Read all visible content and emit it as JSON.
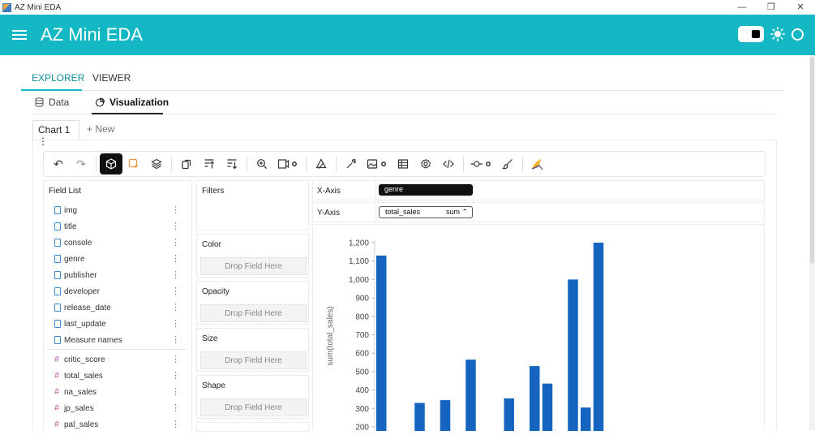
{
  "window": {
    "title": "AZ Mini EDA",
    "controls": [
      "—",
      "❐",
      "✕"
    ]
  },
  "appbar": {
    "title": "AZ Mini EDA"
  },
  "main_tabs": [
    {
      "label": "EXPLORER"
    },
    {
      "label": "VIEWER"
    }
  ],
  "sub_tabs": [
    {
      "label": "Data"
    },
    {
      "label": "Visualization"
    }
  ],
  "chart_tabs": {
    "current": "Chart 1 ⋮",
    "new": "+ New"
  },
  "field_list": {
    "header": "Field List",
    "dimensions": [
      "img",
      "title",
      "console",
      "genre",
      "publisher",
      "developer",
      "release_date",
      "last_update",
      "Measure names"
    ],
    "measures": [
      "critic_score",
      "total_sales",
      "na_sales",
      "jp_sales",
      "pal_sales"
    ]
  },
  "encodings": {
    "filters": "Filters",
    "color": "Color",
    "opacity": "Opacity",
    "size": "Size",
    "shape": "Shape",
    "drop_placeholder": "Drop Field Here"
  },
  "axes": {
    "x_label": "X-Axis",
    "x_field": "genre",
    "y_label": "Y-Axis",
    "y_field": "total_sales",
    "y_agg": "sum ⌃"
  },
  "chart_data": {
    "type": "bar",
    "ylabel": "sum(total_sales)",
    "ylim": [
      200,
      1200
    ],
    "yticks": [
      "1,200",
      "1,100",
      "1,000",
      "900",
      "800",
      "700",
      "600",
      "500",
      "400",
      "300",
      "200"
    ],
    "values": [
      1130,
      0,
      0,
      330,
      0,
      345,
      0,
      565,
      0,
      0,
      355,
      0,
      530,
      435,
      0,
      1000,
      305,
      1200
    ],
    "bar_color": "#1565c0"
  },
  "colors": {
    "accent": "#14b8c4",
    "bar": "#1565c0"
  }
}
